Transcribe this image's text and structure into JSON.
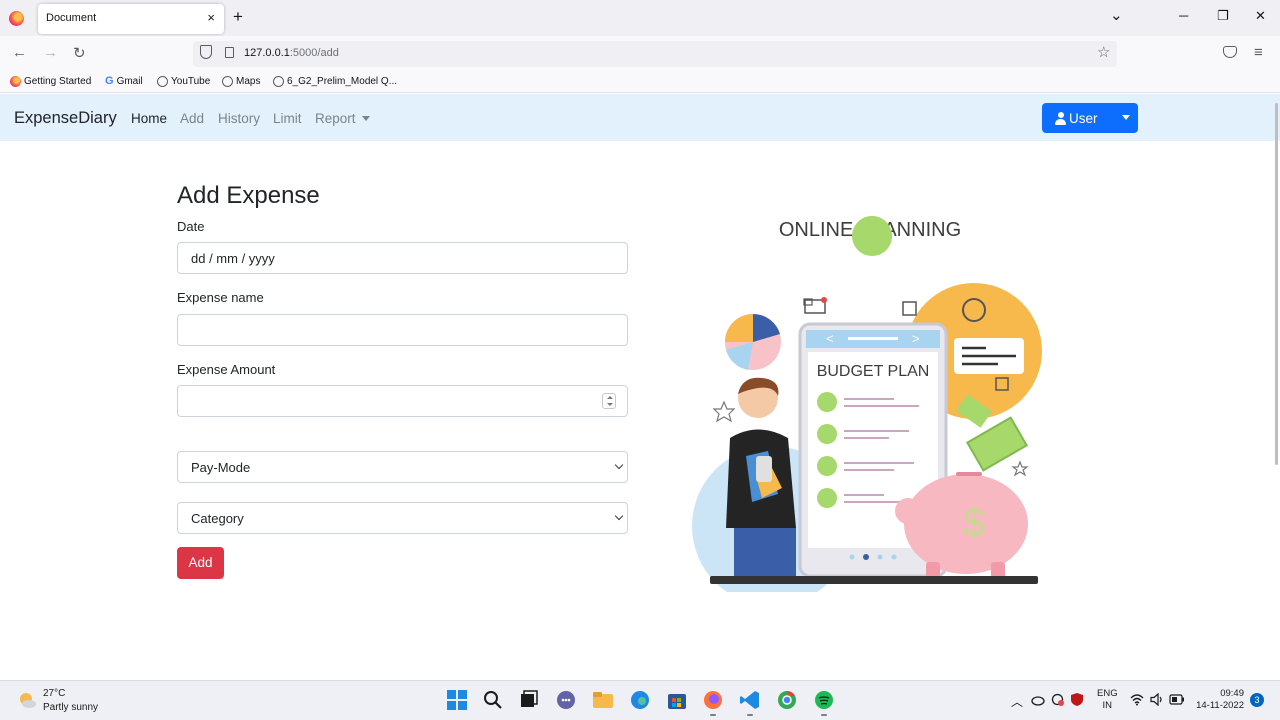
{
  "browser": {
    "tab_title": "Document",
    "tab_close": "×",
    "new_tab": "+",
    "url_host": "127.0.0.1",
    "url_rest": ":5000/add",
    "bookmarks": [
      "Getting Started",
      "Gmail",
      "YouTube",
      "Maps",
      "6_G2_Prelim_Model Q..."
    ],
    "window_controls": {
      "list": "⌄",
      "minimize": "─",
      "restore": "❐",
      "close": "✕"
    },
    "nav": {
      "back": "←",
      "forward": "→",
      "reload": "↻",
      "bookmark_star": "☆",
      "menu": "≡"
    }
  },
  "app": {
    "brand": "ExpenseDiary",
    "nav": [
      "Home",
      "Add",
      "History",
      "Limit",
      "Report"
    ],
    "user_button": "User"
  },
  "form": {
    "heading": "Add Expense",
    "date_label": "Date",
    "date_placeholder": "dd / mm / yyyy",
    "name_label": "Expense name",
    "name_value": "",
    "amount_label": "Expense Amount",
    "amount_value": "",
    "paymode_selected": "Pay-Mode",
    "category_selected": "Category",
    "submit_label": "Add"
  },
  "illustration": {
    "title": "ONLINE PLANNING",
    "card_title": "BUDGET PLAN",
    "currency_symbol": "$",
    "card_nav": {
      "prev": "<",
      "next": ">"
    }
  },
  "taskbar": {
    "temperature": "27°C",
    "weather": "Partly sunny",
    "lang_line1": "ENG",
    "lang_line2": "IN",
    "time": "09:49",
    "date": "14-11-2022",
    "notifications": "3",
    "tray_chevron": "︿"
  },
  "colors": {
    "app_nav_bg": "#e3f1fd",
    "primary": "#0d6efd",
    "danger": "#dc3545"
  }
}
